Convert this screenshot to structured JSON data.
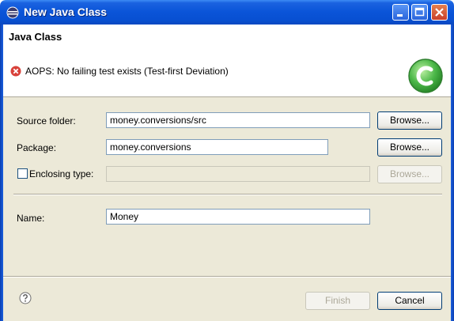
{
  "window": {
    "title": "New Java Class"
  },
  "header": {
    "title": "Java Class",
    "message": "AOPS: No failing test exists (Test-first Deviation)"
  },
  "form": {
    "source_folder": {
      "label": "Source folder:",
      "value": "money.conversions/src",
      "browse": "Browse..."
    },
    "package": {
      "label": "Package:",
      "value": "money.conversions",
      "browse": "Browse..."
    },
    "enclosing_type": {
      "label": "Enclosing type:",
      "value": "",
      "browse": "Browse...",
      "checked": false
    },
    "name": {
      "label": "Name:",
      "value": "Money"
    }
  },
  "footer": {
    "finish": "Finish",
    "cancel": "Cancel"
  },
  "colors": {
    "titlebar": "#0a54d8",
    "error": "#d8413a",
    "badge": "#4bb748"
  }
}
